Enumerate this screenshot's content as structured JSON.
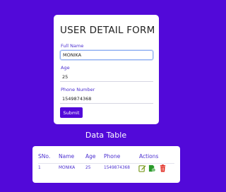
{
  "form": {
    "title": "USER DETAIL FORM",
    "fields": [
      {
        "label": "Full Name",
        "value": "MONIKA"
      },
      {
        "label": "Age",
        "value": "25"
      },
      {
        "label": "Phone Number",
        "value": "1549874368"
      }
    ],
    "submit_label": "Submit"
  },
  "table": {
    "heading": "Data Table",
    "columns": [
      "SNo.",
      "Name",
      "Age",
      "Phone",
      "Actions"
    ],
    "rows": [
      {
        "sno": "1",
        "name": "MONIKA",
        "age": "25",
        "phone": "1549874368"
      }
    ],
    "actions": [
      {
        "icon": "edit-icon",
        "color": "#7a9a1f"
      },
      {
        "icon": "view-user-icon",
        "color": "#2a9a2a"
      },
      {
        "icon": "delete-icon",
        "color": "#e0251b"
      }
    ]
  },
  "colors": {
    "background": "#5209d9",
    "accent": "#4b2fd0",
    "button": "#5209d9"
  }
}
